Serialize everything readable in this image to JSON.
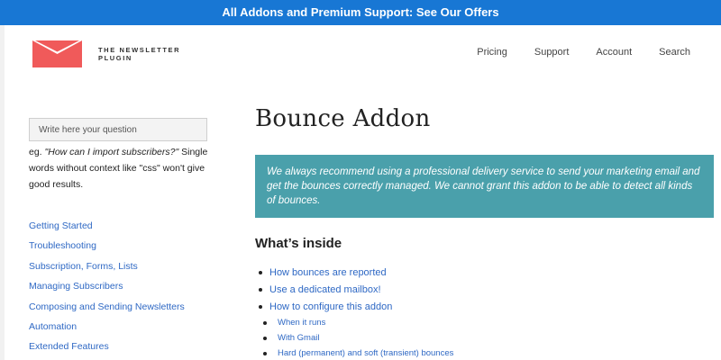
{
  "promo": {
    "text": "All Addons and Premium Support: See Our Offers"
  },
  "brand": {
    "name": "THE NEWSLETTER PLUGIN",
    "logo_icon": "envelope-icon",
    "logo_color": "#f05a5a"
  },
  "nav": {
    "items": [
      {
        "label": "Pricing"
      },
      {
        "label": "Support"
      },
      {
        "label": "Account"
      },
      {
        "label": "Search"
      }
    ]
  },
  "search": {
    "placeholder": "Write here your question",
    "hint_prefix": "eg. ",
    "hint_example": "\"How can I import subscribers?\"",
    "hint_suffix": " Single words without context like \"css\" won't give good results."
  },
  "sidebar": {
    "items": [
      {
        "label": "Getting Started"
      },
      {
        "label": "Troubleshooting"
      },
      {
        "label": "Subscription, Forms, Lists"
      },
      {
        "label": "Managing Subscribers"
      },
      {
        "label": "Composing and Sending Newsletters"
      },
      {
        "label": "Automation"
      },
      {
        "label": "Extended Features"
      }
    ]
  },
  "main": {
    "title": "Bounce Addon",
    "notice": "We always recommend using a professional delivery service to send your marketing email and get the bounces correctly managed. We cannot grant this addon to be able to detect all kinds of bounces.",
    "section_heading": "What’s inside",
    "toc": [
      {
        "label": "How bounces are reported"
      },
      {
        "label": "Use a dedicated mailbox!"
      },
      {
        "label": "How to configure this addon"
      }
    ],
    "toc_sub": [
      {
        "label": "When it runs"
      },
      {
        "label": "With Gmail"
      },
      {
        "label": "Hard (permanent) and soft (transient) bounces"
      }
    ]
  },
  "colors": {
    "promo_bar": "#1877d4",
    "link": "#2e68c4",
    "notice_bg": "#4aa0ab"
  }
}
